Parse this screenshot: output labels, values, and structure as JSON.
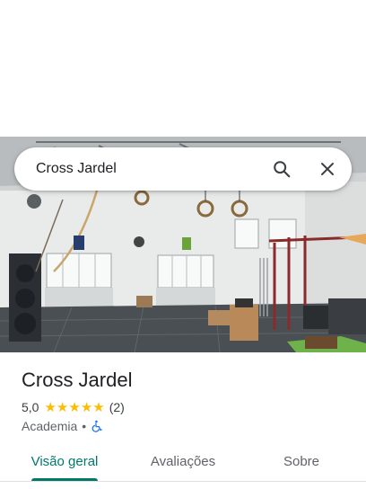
{
  "search": {
    "query": "Cross Jardel"
  },
  "place": {
    "title": "Cross Jardel",
    "rating": "5,0",
    "review_count": "(2)",
    "stars": 5,
    "category": "Academia",
    "separator": "•"
  },
  "tabs": [
    {
      "label": "Visão geral",
      "active": true
    },
    {
      "label": "Avaliações",
      "active": false
    },
    {
      "label": "Sobre",
      "active": false
    }
  ],
  "icons": {
    "search": "search-icon",
    "close": "close-icon",
    "accessibility": "wheelchair-icon"
  },
  "colors": {
    "accent": "#00796b",
    "star": "#fbbc04",
    "accessibility": "#1a73e8"
  }
}
